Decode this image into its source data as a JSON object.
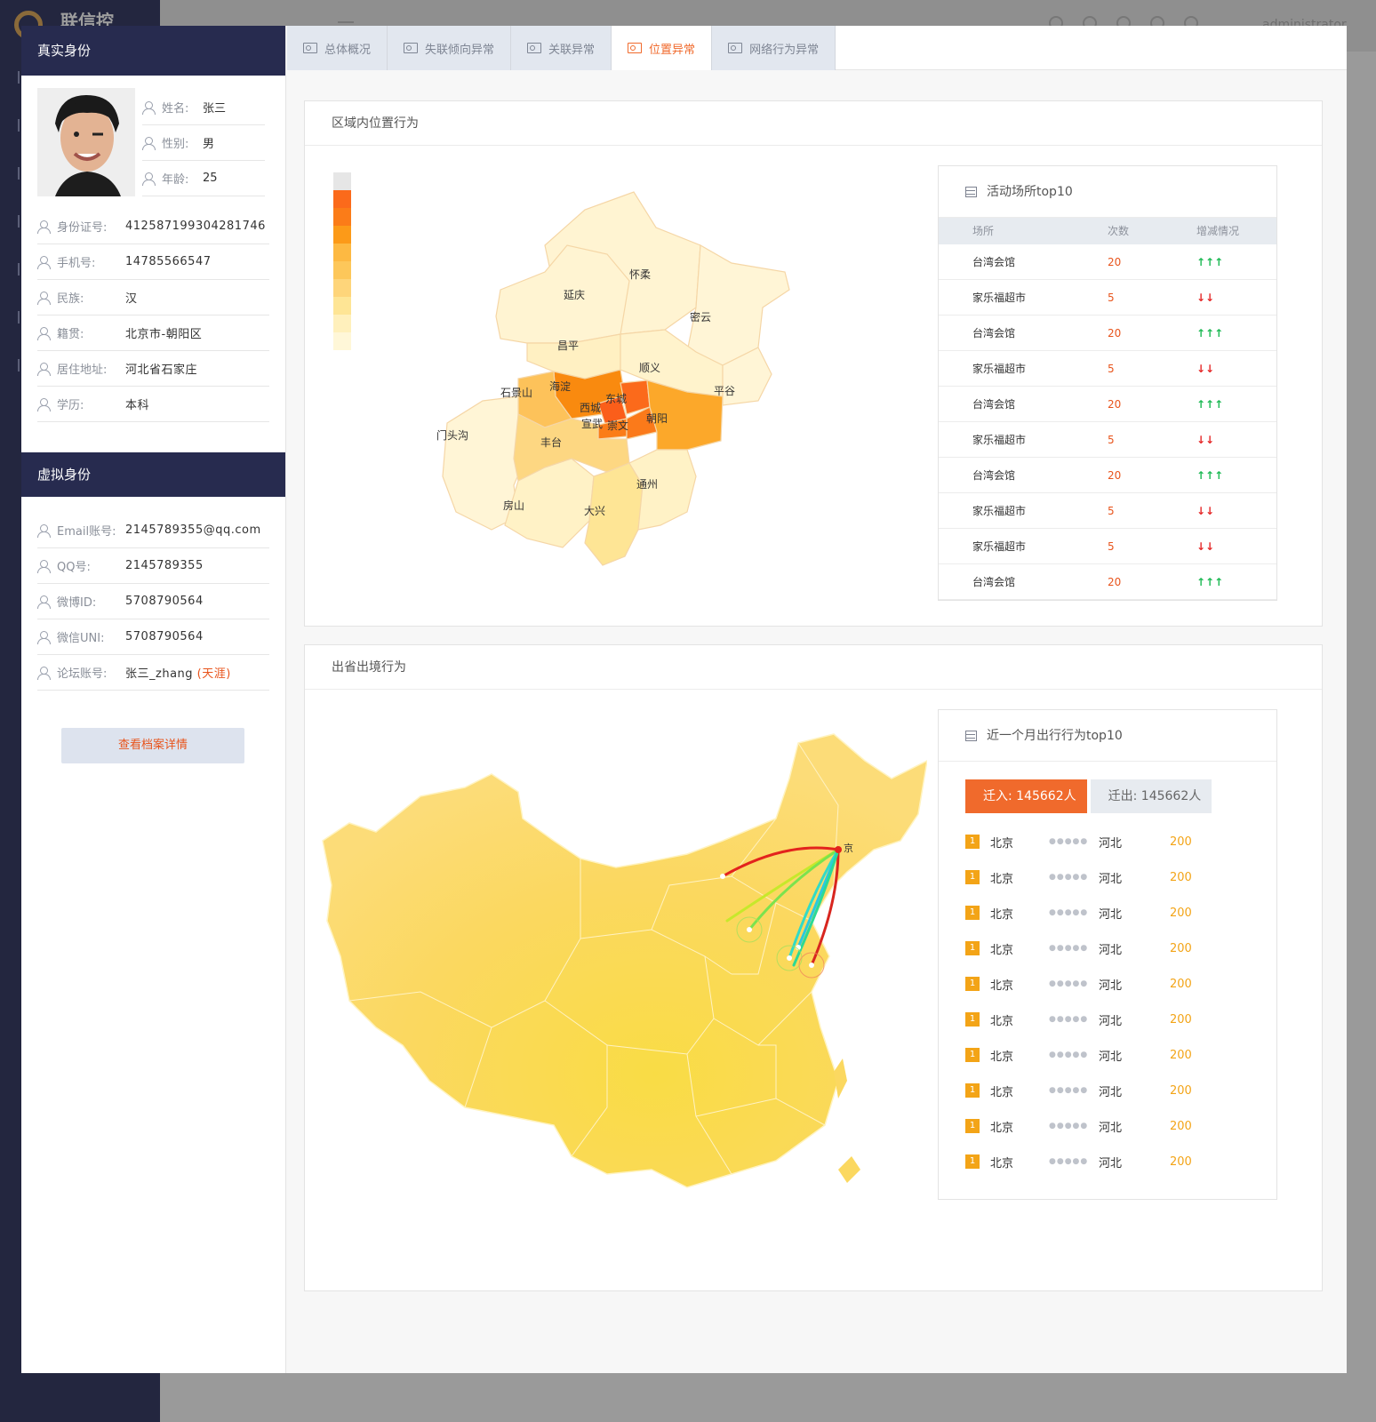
{
  "app": {
    "brand": "联信控",
    "username": "administrator"
  },
  "real_identity": {
    "title": "真实身份",
    "name": {
      "label": "姓名:",
      "value": "张三"
    },
    "gender": {
      "label": "性别:",
      "value": "男"
    },
    "age": {
      "label": "年龄:",
      "value": "25"
    },
    "fields": [
      {
        "label": "身份证号:",
        "value": "412587199304281746"
      },
      {
        "label": "手机号:",
        "value": "14785566547"
      },
      {
        "label": "民族:",
        "value": "汉"
      },
      {
        "label": "籍贯:",
        "value": "北京市-朝阳区"
      },
      {
        "label": "居住地址:",
        "value": "河北省石家庄"
      },
      {
        "label": "学历:",
        "value": "本科"
      }
    ]
  },
  "virtual_identity": {
    "title": "虚拟身份",
    "fields": [
      {
        "label": "Email账号:",
        "value": "2145789355@qq.com"
      },
      {
        "label": "QQ号:",
        "value": "2145789355"
      },
      {
        "label": "微博ID:",
        "value": "5708790564"
      },
      {
        "label": "微信UNI:",
        "value": "5708790564"
      },
      {
        "label": "论坛账号:",
        "value": "张三_zhang",
        "extra": "(天涯)"
      }
    ],
    "detail_button": "查看档案详情"
  },
  "tabs": [
    {
      "label": "总体概况",
      "active": false
    },
    {
      "label": "失联倾向异常",
      "active": false
    },
    {
      "label": "关联异常",
      "active": false
    },
    {
      "label": "位置异常",
      "active": true
    },
    {
      "label": "网络行为异常",
      "active": false
    }
  ],
  "regional": {
    "title": "区域内位置行为",
    "legend_colors": [
      "#e6e6e6",
      "#fb6a1b",
      "#fb7c18",
      "#fc9a18",
      "#fdb942",
      "#fdc75a",
      "#fed57a",
      "#fee595",
      "#fff0bc",
      "#fff7d8"
    ],
    "districts": [
      "延庆",
      "怀柔",
      "密云",
      "昌平",
      "顺义",
      "平谷",
      "海淀",
      "石景山",
      "西城",
      "东城",
      "宣武",
      "崇文",
      "朝阳",
      "门头沟",
      "丰台",
      "房山",
      "大兴",
      "通州"
    ],
    "top10": {
      "title": "活动场所top10",
      "headers": [
        "场所",
        "次数",
        "增减情况"
      ],
      "rows": [
        {
          "place": "台湾会馆",
          "count": "20",
          "trend": "↑↑↑",
          "dir": "up"
        },
        {
          "place": "家乐福超市",
          "count": "5",
          "trend": "↓↓",
          "dir": "down"
        },
        {
          "place": "台湾会馆",
          "count": "20",
          "trend": "↑↑↑",
          "dir": "up"
        },
        {
          "place": "家乐福超市",
          "count": "5",
          "trend": "↓↓",
          "dir": "down"
        },
        {
          "place": "台湾会馆",
          "count": "20",
          "trend": "↑↑↑",
          "dir": "up"
        },
        {
          "place": "家乐福超市",
          "count": "5",
          "trend": "↓↓",
          "dir": "down"
        },
        {
          "place": "台湾会馆",
          "count": "20",
          "trend": "↑↑↑",
          "dir": "up"
        },
        {
          "place": "家乐福超市",
          "count": "5",
          "trend": "↓↓",
          "dir": "down"
        },
        {
          "place": "家乐福超市",
          "count": "5",
          "trend": "↓↓",
          "dir": "down"
        },
        {
          "place": "台湾会馆",
          "count": "20",
          "trend": "↑↑↑",
          "dir": "up"
        }
      ]
    }
  },
  "travel": {
    "title": "出省出境行为",
    "map_label": "京",
    "top10": {
      "title": "近一个月出行行为top10",
      "tab_in": "迁入: 145662人",
      "tab_out": "迁出: 145662人",
      "rows": [
        {
          "rank": "1",
          "from": "北京",
          "dots": "●●●●●",
          "to": "河北",
          "num": "200"
        },
        {
          "rank": "1",
          "from": "北京",
          "dots": "●●●●●",
          "to": "河北",
          "num": "200"
        },
        {
          "rank": "1",
          "from": "北京",
          "dots": "●●●●●",
          "to": "河北",
          "num": "200"
        },
        {
          "rank": "1",
          "from": "北京",
          "dots": "●●●●●",
          "to": "河北",
          "num": "200"
        },
        {
          "rank": "1",
          "from": "北京",
          "dots": "●●●●●",
          "to": "河北",
          "num": "200"
        },
        {
          "rank": "1",
          "from": "北京",
          "dots": "●●●●●",
          "to": "河北",
          "num": "200"
        },
        {
          "rank": "1",
          "from": "北京",
          "dots": "●●●●●",
          "to": "河北",
          "num": "200"
        },
        {
          "rank": "1",
          "from": "北京",
          "dots": "●●●●●",
          "to": "河北",
          "num": "200"
        },
        {
          "rank": "1",
          "from": "北京",
          "dots": "●●●●●",
          "to": "河北",
          "num": "200"
        },
        {
          "rank": "1",
          "from": "北京",
          "dots": "●●●●●",
          "to": "河北",
          "num": "200"
        }
      ]
    }
  }
}
